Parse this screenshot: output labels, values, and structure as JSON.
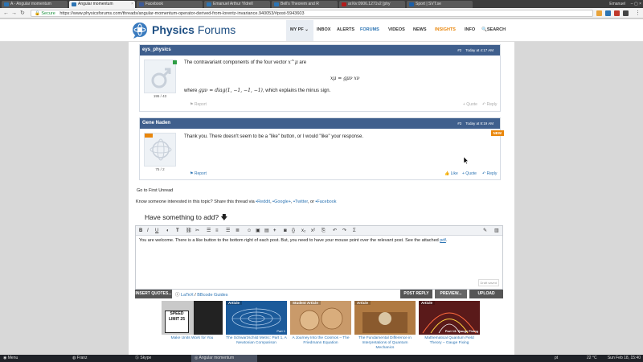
{
  "browser": {
    "tabs": [
      {
        "label": "A - Angular momentum",
        "color": "#2c74b3"
      },
      {
        "label": "Angular momentum",
        "color": "#2c74b3"
      },
      {
        "label": "Facebook",
        "color": "#3b5998"
      },
      {
        "label": "Emanuel Arthur Yldrell",
        "color": "#2c74b3"
      },
      {
        "label": "Bell's Theorem and R",
        "color": "#2c74b3"
      },
      {
        "label": "arXiv:0906.1271v2 [phy",
        "color": "#b31b1b"
      },
      {
        "label": "Sport | SVT.se",
        "color": "#1a5faa"
      }
    ],
    "profile_name": "Emanuel",
    "secure_label": "Secure",
    "url": "https://www.physicsforums.com/threads/angular-momentum-operator-derived-from-lorentz-invariance.940053/#post-5943603"
  },
  "site": {
    "brand_word1": "Physics",
    "brand_word2": "Forums",
    "nav": {
      "mypf": "MY PF",
      "inbox": "INBOX",
      "alerts": "ALERTS",
      "forums": "FORUMS",
      "videos": "VIDEOS",
      "news": "NEWS",
      "insights": "INSIGHTS",
      "info": "INFO",
      "search": "SEARCH"
    }
  },
  "posts": [
    {
      "author": "eys_physics",
      "post_no": "#2",
      "time": "Today at 4:17 AM",
      "counts": "195 / 43",
      "text1": "The contravariant components of the four vector",
      "text1_var": "x^μ",
      "text1_end": "are",
      "equation": "xμ = gμν xν",
      "text2_start": "where",
      "text2_math": "gμν = diag(1, −1, −1, −1)",
      "text2_end": ", which explains the minus sign.",
      "report": "Report",
      "quote": "+ Quote",
      "reply": "Reply"
    },
    {
      "author": "Gene Naden",
      "post_no": "#3",
      "time": "Today at 8:19 AM",
      "counts": "75 / 2",
      "badge": "NEW",
      "text": "Thank you. There doesn't seem to be a \"like\" button, or I would \"like\" your response.",
      "report": "Report",
      "like": "Like",
      "quote": "+ Quote",
      "reply": "Reply"
    }
  ],
  "thread": {
    "go_first_unread": "Go to First Unread",
    "share_prefix": "Know someone interested in this topic? Share this thread via",
    "reddit": "Reddit",
    "googleplus": "Google+",
    "twitter": "Twitter",
    "or": "or",
    "facebook": "Facebook"
  },
  "composer": {
    "heading": "Have something to add?",
    "text_start": "You are welcome. There is a like button to the bottom right of each post. But, you need to have your mouse point over the relevant post. See the attached",
    "text_link": "pdf",
    "text_end": ".",
    "draft": "Draft saved",
    "insert_quotes": "INSERT QUOTES...",
    "latex": "LaTeX",
    "bbcode": "BBcode Guides",
    "post_reply": "POST REPLY",
    "preview": "PREVIEW...",
    "upload": "UPLOAD"
  },
  "cards": [
    {
      "tag": "",
      "title": "Make Units Work for You",
      "overlay": "SPEED LIMIT 25",
      "color": "#c9c9c9"
    },
    {
      "tag": "Article",
      "title": "The Schwarzschild Metric: Part 1, A Newtonian Comparison",
      "overlay": "Part 1",
      "color": "#1b5a9a"
    },
    {
      "tag": "Student Article",
      "title": "A Journey Into the Cosmos – The Friedmann Equation",
      "overlay": "",
      "color": "#c99a6a"
    },
    {
      "tag": "Article",
      "title": "The Fundamental Difference in Interpretations of Quantum Mechanics",
      "overlay": "",
      "color": "#b07a42"
    },
    {
      "tag": "Article",
      "title": "Mathematical Quantum Field Theory – Gauge Fixing",
      "overlay": "Part 13: Gauge Fixing",
      "color": "#5a1a1a"
    }
  ],
  "taskbar": {
    "menu": "Menu",
    "franz": "Franz",
    "skype": "Skype",
    "active_window": "Angular momentum",
    "clock": "Sun Feb 18, 15:40",
    "temp": "22 °C",
    "lang": "pt"
  }
}
